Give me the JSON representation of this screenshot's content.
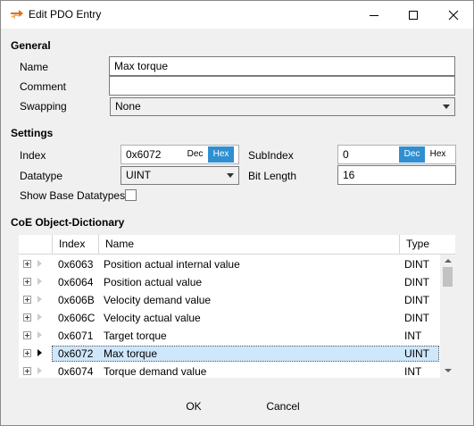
{
  "window": {
    "title": "Edit PDO Entry"
  },
  "general": {
    "heading": "General",
    "name_label": "Name",
    "name_value": "Max torque",
    "comment_label": "Comment",
    "comment_value": "",
    "swapping_label": "Swapping",
    "swapping_value": "None"
  },
  "settings": {
    "heading": "Settings",
    "index_label": "Index",
    "index_value": "0x6072",
    "subindex_label": "SubIndex",
    "subindex_value": "0",
    "dec_label": "Dec",
    "hex_label": "Hex",
    "datatype_label": "Datatype",
    "datatype_value": "UINT",
    "bitlength_label": "Bit Length",
    "bitlength_value": "16",
    "show_base_label": "Show Base Datatypes"
  },
  "dictionary": {
    "heading": "CoE Object-Dictionary",
    "columns": [
      "Index",
      "Name",
      "Type"
    ],
    "rows": [
      {
        "index": "0x6063",
        "name": "Position actual internal value",
        "type": "DINT"
      },
      {
        "index": "0x6064",
        "name": "Position actual value",
        "type": "DINT"
      },
      {
        "index": "0x606B",
        "name": "Velocity demand value",
        "type": "DINT"
      },
      {
        "index": "0x606C",
        "name": "Velocity actual value",
        "type": "DINT"
      },
      {
        "index": "0x6071",
        "name": "Target torque",
        "type": "INT"
      },
      {
        "index": "0x6072",
        "name": "Max torque",
        "type": "UINT"
      },
      {
        "index": "0x6074",
        "name": "Torque demand value",
        "type": "INT"
      }
    ],
    "selected_index": "0x6072"
  },
  "footer": {
    "ok_label": "OK",
    "cancel_label": "Cancel"
  },
  "colors": {
    "accent": "#2f8fd0",
    "selection": "#cfe7fb"
  }
}
